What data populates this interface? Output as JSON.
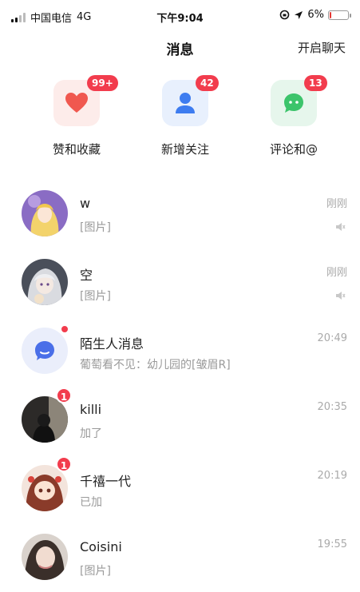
{
  "status_bar": {
    "carrier": "中国电信",
    "network": "4G",
    "time": "下午9:04",
    "battery_percent": "6%",
    "battery_level": 0.06,
    "battery_color": "#e53935"
  },
  "header": {
    "title": "消息",
    "action_label": "开启聊天"
  },
  "quick_actions": [
    {
      "label": "赞和收藏",
      "badge": "99+",
      "icon": "heart-icon",
      "tile_color": "#fdecea",
      "icon_color": "#f0584f"
    },
    {
      "label": "新增关注",
      "badge": "42",
      "icon": "person-icon",
      "tile_color": "#e8f0fd",
      "icon_color": "#3d7cf0"
    },
    {
      "label": "评论和@",
      "badge": "13",
      "icon": "chat-bubble-icon",
      "tile_color": "#e6f6ec",
      "icon_color": "#3cc46b"
    }
  ],
  "messages": [
    {
      "name": "w",
      "preview": "[图片]",
      "time": "刚刚",
      "muted": true
    },
    {
      "name": "空",
      "preview": "[图片]",
      "time": "刚刚",
      "muted": true
    },
    {
      "name": "陌生人消息",
      "preview": "葡萄看不见：幼儿园的[皱眉R]",
      "time": "20:49",
      "unread_dot": true
    },
    {
      "name": "killi",
      "preview": "加了",
      "time": "20:35",
      "badge": "1"
    },
    {
      "name": "千禧一代",
      "preview": "已加",
      "time": "20:19",
      "badge": "1"
    },
    {
      "name": "Coisini",
      "preview": "[图片]",
      "time": "19:55"
    }
  ],
  "colors": {
    "badge": "#f23c4d",
    "secondary_text": "#9a9a9a"
  }
}
